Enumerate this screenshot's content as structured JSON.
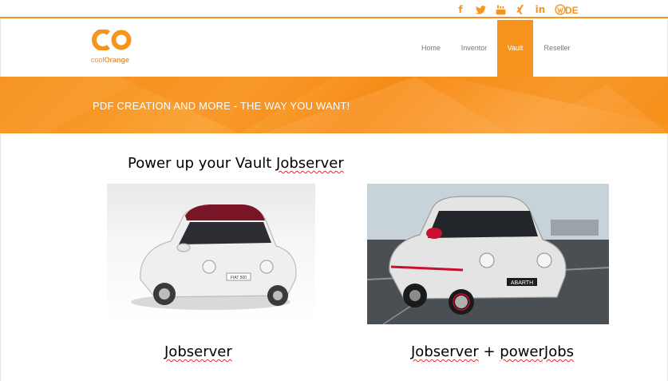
{
  "social": {
    "icons": [
      {
        "name": "facebook-icon",
        "glyph": "f"
      },
      {
        "name": "twitter-icon",
        "glyph": "🐦"
      },
      {
        "name": "youtube-icon",
        "glyph": "▶"
      },
      {
        "name": "xing-icon",
        "glyph": "✕"
      },
      {
        "name": "linkedin-icon",
        "glyph": "in"
      },
      {
        "name": "wordpress-icon",
        "glyph": "W"
      }
    ],
    "language": "DE"
  },
  "brand": {
    "logo_mark": "co",
    "name_prefix": "cool",
    "name_suffix": "Orange",
    "color": "#f7941d"
  },
  "nav": {
    "items": [
      "Home",
      "Inventor",
      "Vault",
      "Reseller"
    ],
    "active": "Vault"
  },
  "banner": {
    "text": "PDF CREATION AND MORE - THE WAY YOU WANT!"
  },
  "content": {
    "headline_prefix": "Power up your Vault ",
    "headline_word": "Jobserver",
    "caption_left": "Jobserver",
    "caption_right_a": "Jobserver",
    "caption_right_b": " + ",
    "caption_right_c": "powerJobs",
    "plate_right": "ABARTH",
    "plate_left": "FIAT 500"
  }
}
